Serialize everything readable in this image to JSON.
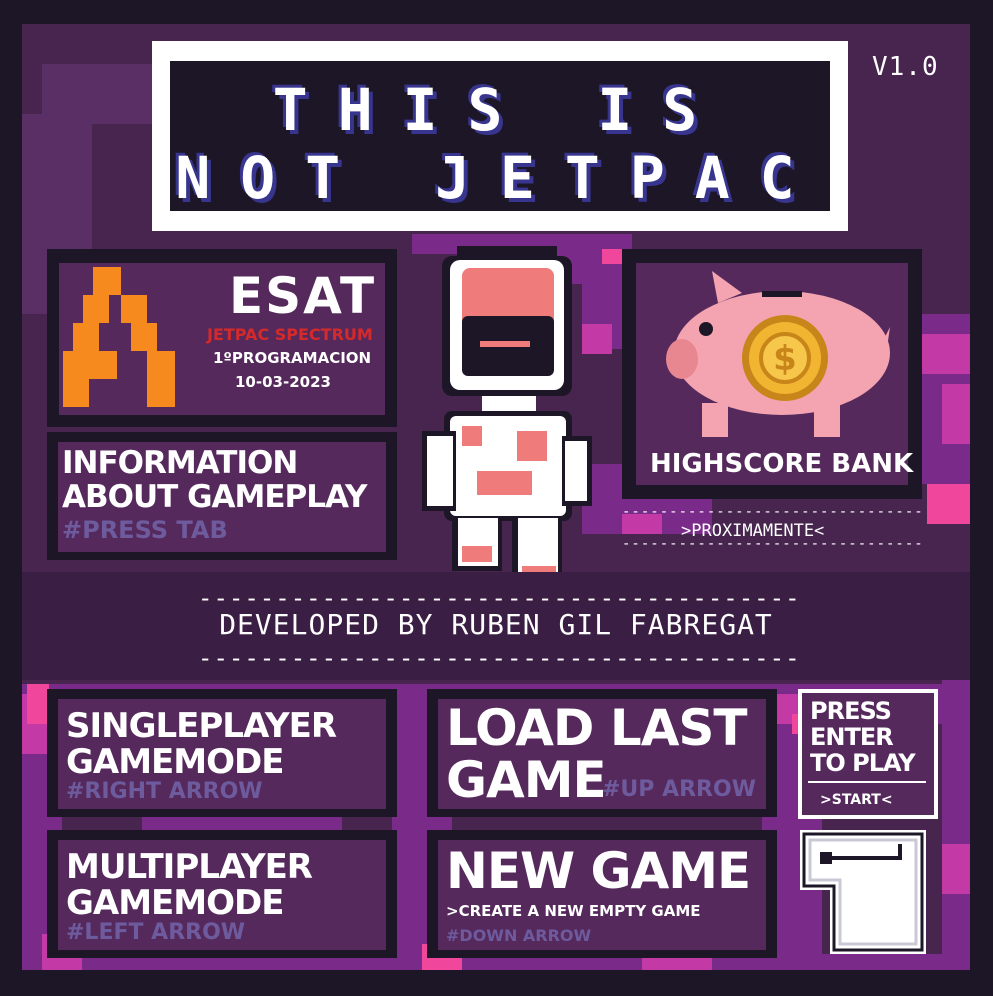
{
  "title": {
    "line1": "THIS IS",
    "line2": "NOT JETPAC"
  },
  "version": "V1.0",
  "esat": {
    "logo_text": "ESAT",
    "subtitle": "JETPAC SPECTRUM",
    "course": "1ºPROGRAMACION",
    "date": "10-03-2023"
  },
  "info": {
    "line1": "INFORMATION",
    "line2": "ABOUT GAMEPLAY",
    "hint": "#PRESS TAB"
  },
  "highscore": {
    "label": "HIGHSCORE BANK",
    "coming_soon": ">PROXIMAMENTE<"
  },
  "developer": {
    "text": "DEVELOPED BY RUBEN GIL FABREGAT"
  },
  "single": {
    "line1": "SINGLEPLAYER",
    "line2": "GAMEMODE",
    "hint": "#RIGHT ARROW"
  },
  "multi": {
    "line1": "MULTIPLAYER",
    "line2": "GAMEMODE",
    "hint": "#LEFT ARROW"
  },
  "load": {
    "line1": "LOAD LAST",
    "line2": "GAME",
    "hint": "#UP ARROW"
  },
  "new_game": {
    "line1": "NEW GAME",
    "desc": ">CREATE A NEW EMPTY GAME",
    "hint": "#DOWN ARROW"
  },
  "start": {
    "line1": "PRESS",
    "line2": "ENTER",
    "line3": "TO PLAY",
    "button": ">START<"
  },
  "colors": {
    "background": "#47254f",
    "panel": "#56295d",
    "frame": "#1c1627",
    "accent_pink": "#f0469b",
    "title_shadow": "#38358f",
    "hint": "#6e5b9e",
    "esat_orange": "#f68a1f",
    "esat_red": "#d42a2a"
  },
  "icons": {
    "mascot": "astronaut-icon",
    "bank": "piggy-bank-icon",
    "coin": "coin-icon",
    "enter": "enter-key-icon",
    "logo": "esat-logo-icon"
  }
}
